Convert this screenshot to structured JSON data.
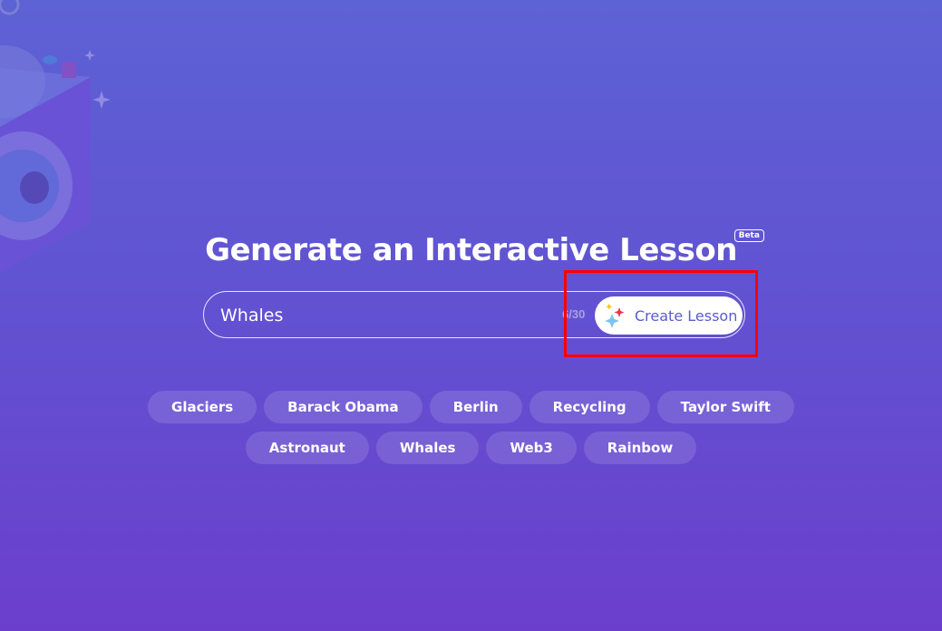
{
  "header": {
    "title": "Generate an Interactive Lesson",
    "badge": "Beta"
  },
  "search": {
    "value": "Whales",
    "counter": "6/30",
    "button_label": "Create Lesson",
    "button_icon": "sparkles-icon"
  },
  "suggestions": {
    "row1": [
      "Glaciers",
      "Barack Obama",
      "Berlin",
      "Recycling",
      "Taylor Swift"
    ],
    "row2": [
      "Astronaut",
      "Whales",
      "Web3",
      "Rainbow"
    ]
  },
  "colors": {
    "accent": "#5b5bcf",
    "highlight": "#ff0000",
    "background_top": "#5d62d4",
    "background_bottom": "#6b3fcc"
  }
}
